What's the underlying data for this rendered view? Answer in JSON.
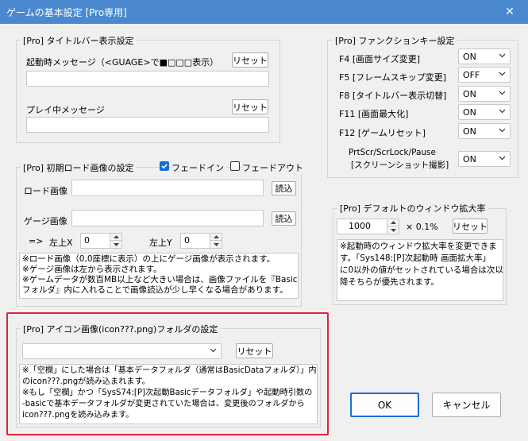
{
  "window": {
    "title": "ゲームの基本設定 [Pro専用]"
  },
  "titlebar": {
    "close_glyph": "✕"
  },
  "titlebar_group": {
    "title": "[Pro] タイトルバー表示設定",
    "startup_label": "起動時メッセージ（<GUAGE>で■□□□表示）",
    "startup_reset": "リセット",
    "startup_value": "",
    "playing_label": "プレイ中メッセージ",
    "playing_reset": "リセット",
    "playing_value": ""
  },
  "function_keys": {
    "title": "[Pro] ファンクションキー設定",
    "rows": [
      {
        "label": "F4 [画面サイズ変更]",
        "value": "ON"
      },
      {
        "label": "F5 [フレームスキップ変更]",
        "value": "OFF"
      },
      {
        "label": "F8 [タイトルバー表示切替]",
        "value": "ON"
      },
      {
        "label": "F11 [画面最大化]",
        "value": "ON"
      },
      {
        "label": "F12 [ゲームリセット]",
        "value": "ON"
      }
    ],
    "prtscr_label_1": "PrtScr/ScrLock/Pause",
    "prtscr_label_2": "[スクリーンショット撮影]",
    "prtscr_value": "ON"
  },
  "initial_load": {
    "title": "[Pro] 初期ロード画像の設定",
    "fade_in_label": "フェードイン",
    "fade_in_checked": true,
    "fade_out_label": "フェードアウト",
    "fade_out_checked": false,
    "load_image_label": "ロード画像",
    "load_image_value": "",
    "load_button": "読込",
    "gauge_image_label": "ゲージ画像",
    "gauge_image_value": "",
    "gauge_button": "読込",
    "arrow_label": "=>",
    "left_x_label": "左上X",
    "left_x_value": "0",
    "left_y_label": "左上Y",
    "left_y_value": "0",
    "memo_lines": [
      "※ロード画像（0,0座標に表示）の上にゲージ画像が表示されます。",
      "※ゲージ画像は左から表示されます。",
      "※ゲームデータが数百MB以上など大きい場合は、画像ファイルを『BasicData",
      "フォルダ』内に入れることで画像読込が少し早くなる場合があります。"
    ]
  },
  "window_scale": {
    "title": "[Pro] デフォルトのウィンドウ拡大率",
    "value": "1000",
    "unit": "× 0.1%",
    "reset": "リセット",
    "memo_lines": [
      "※起動時のウィンドウ拡大率を変更できま",
      "す。「Sys148:[P]次起動時 画面拡大率」",
      "に0以外の値がセットされている場合は次以",
      "降そちらが優先されます。"
    ]
  },
  "icon_folder": {
    "title": "[Pro] アイコン画像(icon???.png)フォルダの設定",
    "select_value": "",
    "reset": "リセット",
    "memo_lines": [
      "※「空欄」にした場合は「基本データフォルダ（通常はBasicDataフォルダ）」内",
      "のicon???.pngが読み込まれます。",
      "※もし「空欄」かつ「SysS74:[P]次起動Basicデータフォルダ」や起動時引数の",
      "-basicで基本データフォルダが変更されていた場合は、変更後のフォルダから",
      "icon???.pngを読み込みます。"
    ]
  },
  "footer": {
    "ok": "OK",
    "cancel": "キャンセル"
  },
  "colors": {
    "titlebar": "#4a89d0",
    "highlight": "#e0243a",
    "ok_border": "#1a6fd1"
  }
}
